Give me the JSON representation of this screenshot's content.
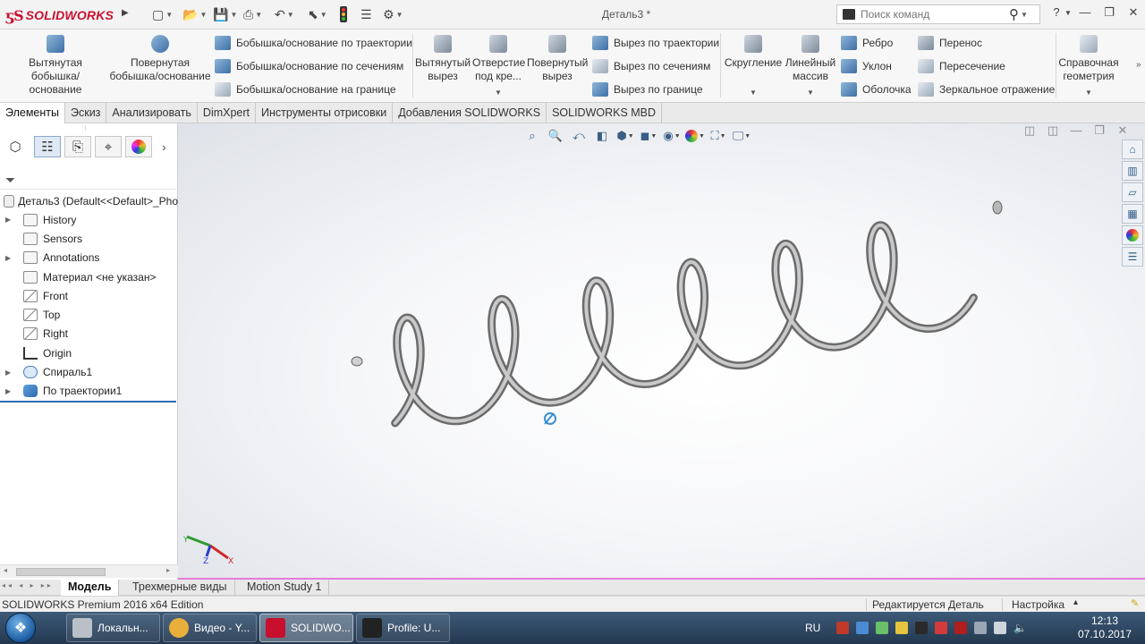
{
  "app": {
    "logo_ds": "ƽS",
    "logo_name": "SOLIDWORKS",
    "document_title": "Деталь3 *",
    "search_placeholder": "Поиск команд",
    "help_label": "?"
  },
  "ribbon": {
    "extruded_boss": "Вытянутая бобышка/основание",
    "revolved_boss": "Повернутая бобышка/основание",
    "swept_boss": "Бобышка/основание по траектории",
    "lofted_boss": "Бобышка/основание по сечениям",
    "boundary_boss": "Бобышка/основание на границе",
    "extruded_cut": "Вытянутый вырез",
    "hole_wizard": "Отверстие под кре...",
    "revolved_cut": "Повернутый вырез",
    "swept_cut": "Вырез по траектории",
    "lofted_cut": "Вырез по сечениям",
    "boundary_cut": "Вырез по границе",
    "fillet": "Скругление",
    "linear_pattern": "Линейный массив",
    "rib": "Ребро",
    "draft": "Уклон",
    "shell": "Оболочка",
    "wrap": "Перенос",
    "intersect": "Пересечение",
    "mirror": "Зеркальное отражение",
    "ref_geometry": "Справочная геометрия"
  },
  "tabs": [
    "Элементы",
    "Эскиз",
    "Анализировать",
    "DimXpert",
    "Инструменты отрисовки",
    "Добавления SOLIDWORKS",
    "SOLIDWORKS MBD"
  ],
  "tree": {
    "root": "Деталь3  (Default<<Default>_Pho",
    "items": [
      {
        "label": "History",
        "expandable": true,
        "icon": "folder-history-icon"
      },
      {
        "label": "Sensors",
        "expandable": false,
        "icon": "sensor-icon"
      },
      {
        "label": "Annotations",
        "expandable": true,
        "icon": "annotations-icon"
      },
      {
        "label": "Материал <не указан>",
        "expandable": false,
        "icon": "material-icon"
      },
      {
        "label": "Front",
        "expandable": false,
        "icon": "plane-icon"
      },
      {
        "label": "Top",
        "expandable": false,
        "icon": "plane-icon"
      },
      {
        "label": "Right",
        "expandable": false,
        "icon": "plane-icon"
      },
      {
        "label": "Origin",
        "expandable": false,
        "icon": "origin-icon"
      },
      {
        "label": "Спираль1",
        "expandable": true,
        "icon": "helix-icon"
      },
      {
        "label": "По траектории1",
        "expandable": true,
        "icon": "sweep-icon"
      }
    ]
  },
  "bottom_tabs": [
    "Модель",
    "Трехмерные виды",
    "Motion Study 1"
  ],
  "status": {
    "edition": "SOLIDWORKS Premium 2016 x64 Edition",
    "editing": "Редактируется Деталь",
    "settings": "Настройка"
  },
  "taskbar": {
    "tasks": [
      {
        "label": "Локальн...",
        "active": false
      },
      {
        "label": "Видео - Y...",
        "active": false
      },
      {
        "label": "SOLIDWO...",
        "active": true
      },
      {
        "label": "Profile: U...",
        "active": false
      }
    ],
    "language": "RU",
    "time": "12:13",
    "date": "07.10.2017"
  },
  "colors": {
    "brand_red": "#c8102e",
    "viewport_border": "#e87ad9",
    "tree_selection": "#2d6db4"
  }
}
